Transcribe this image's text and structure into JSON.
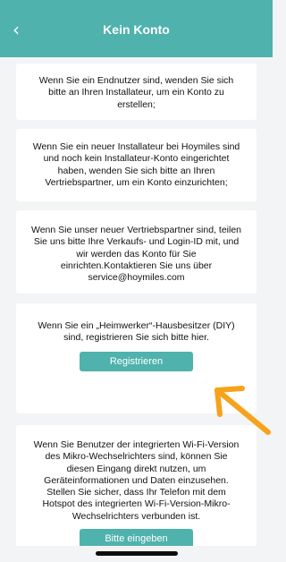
{
  "header": {
    "title": "Kein Konto",
    "back_icon": "chevron-left-icon"
  },
  "cards": [
    {
      "text": "Wenn Sie ein Endnutzer sind, wenden Sie sich bitte an Ihren Installateur, um ein Konto zu erstellen;"
    },
    {
      "text": "Wenn Sie ein neuer Installateur bei Hoymiles sind und noch kein Installateur-Konto eingerichtet haben, wenden Sie sich bitte an Ihren Vertriebspartner, um ein Konto einzurichten;"
    },
    {
      "text": "Wenn Sie unser neuer Vertriebspartner sind, teilen Sie uns bitte Ihre Verkaufs- und Login-ID mit, und wir werden das Konto für Sie einrichten.Kontaktieren Sie uns über service@hoymiles.com"
    },
    {
      "text": "Wenn Sie ein „Heimwerker“-Hausbesitzer (DIY) sind, registrieren Sie sich bitte hier.",
      "button": "Registrieren"
    },
    {
      "text": "Wenn Sie Benutzer der integrierten Wi-Fi-Version des Mikro-Wechselrichters sind, können Sie diesen Eingang direkt nutzen, um Geräteinformationen und Daten einzusehen. Stellen Sie sicher, dass Ihr Telefon mit dem Hotspot des integrierten Wi-Fi-Version-Mikro-Wechselrichters verbunden ist.",
      "button": "Bitte eingeben"
    }
  ],
  "colors": {
    "accent": "#4fb2ad",
    "background": "#f3f4f5",
    "annotation_arrow": "#f7a21b"
  },
  "annotation": {
    "icon": "arrow-pointer-icon"
  }
}
